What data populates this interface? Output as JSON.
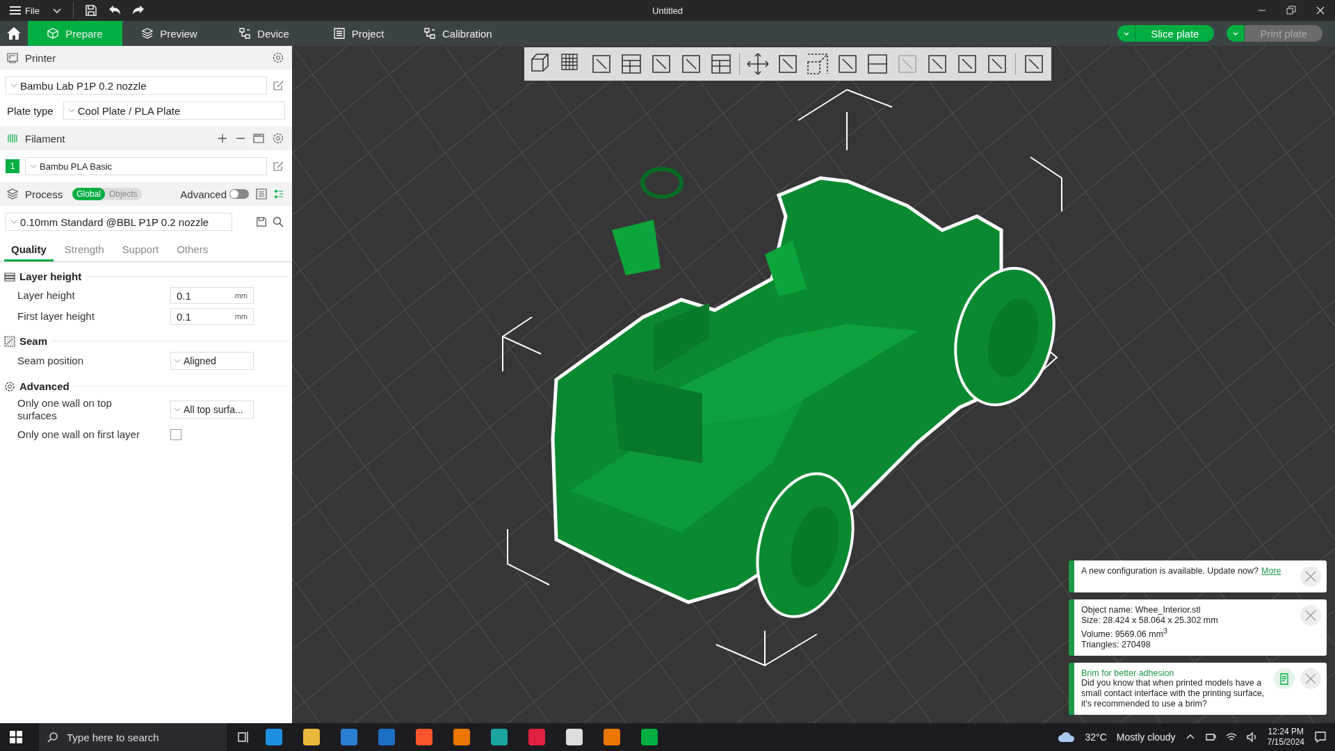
{
  "titlebar": {
    "menu": "File",
    "title": "Untitled"
  },
  "tabs": [
    {
      "label": "Prepare",
      "selected": true
    },
    {
      "label": "Preview",
      "selected": false
    },
    {
      "label": "Device",
      "selected": false
    },
    {
      "label": "Project",
      "selected": false
    },
    {
      "label": "Calibration",
      "selected": false
    }
  ],
  "actions": [
    {
      "label": "Slice plate",
      "disabled": false
    },
    {
      "label": "Print plate",
      "disabled": true
    }
  ],
  "printer": {
    "heading": "Printer",
    "preset": "Bambu Lab P1P 0.2 nozzle",
    "plate_label": "Plate type",
    "plate": "Cool Plate / PLA Plate"
  },
  "filament": {
    "heading": "Filament",
    "slots": [
      {
        "number": "1",
        "name": "Bambu PLA Basic",
        "color": "#00ae42"
      }
    ]
  },
  "process": {
    "heading": "Process",
    "scope": [
      {
        "label": "Global",
        "selected": true
      },
      {
        "label": "Objects",
        "selected": false
      }
    ],
    "advanced_label": "Advanced",
    "advanced_on": false,
    "preset": "0.10mm Standard @BBL P1P 0.2 nozzle"
  },
  "setting_tabs": [
    {
      "label": "Quality",
      "selected": true
    },
    {
      "label": "Strength",
      "selected": false
    },
    {
      "label": "Support",
      "selected": false
    },
    {
      "label": "Others",
      "selected": false
    }
  ],
  "groups": [
    {
      "title": "Layer height",
      "rows": [
        {
          "kind": "number",
          "label": "Layer height",
          "value": "0.1",
          "unit": "mm"
        },
        {
          "kind": "number",
          "label": "First layer height",
          "value": "0.1",
          "unit": "mm"
        }
      ]
    },
    {
      "title": "Seam",
      "rows": [
        {
          "kind": "select",
          "label": "Seam position",
          "value": "Aligned"
        }
      ]
    },
    {
      "title": "Advanced",
      "rows": [
        {
          "kind": "select",
          "label": "Only one wall on top surfaces",
          "value": "All top surfa..."
        },
        {
          "kind": "checkbox",
          "label": "Only one wall on first layer",
          "checked": false
        }
      ]
    }
  ],
  "notifications": [
    {
      "kind": "update",
      "text": "A new configuration is available. Update now?",
      "link": "More"
    },
    {
      "kind": "info",
      "lines": [
        "Object name: Whee_Interior.stl",
        "Size: 28.424 x 58.064 x 25.302 mm",
        "Volume: 9569.06 mm$^{3}$",
        "Triangles: 270498"
      ]
    },
    {
      "kind": "tip",
      "title": "Brim for better adhesion",
      "text": "Did you know that when printed models have a small contact interface with the printing surface, it's recommended to use a brim?"
    }
  ],
  "taskbar": {
    "search_placeholder": "Type here to search",
    "temperature": "32°C",
    "weather": "Mostly cloudy",
    "time": "12:24 PM",
    "date": "7/15/2024"
  }
}
